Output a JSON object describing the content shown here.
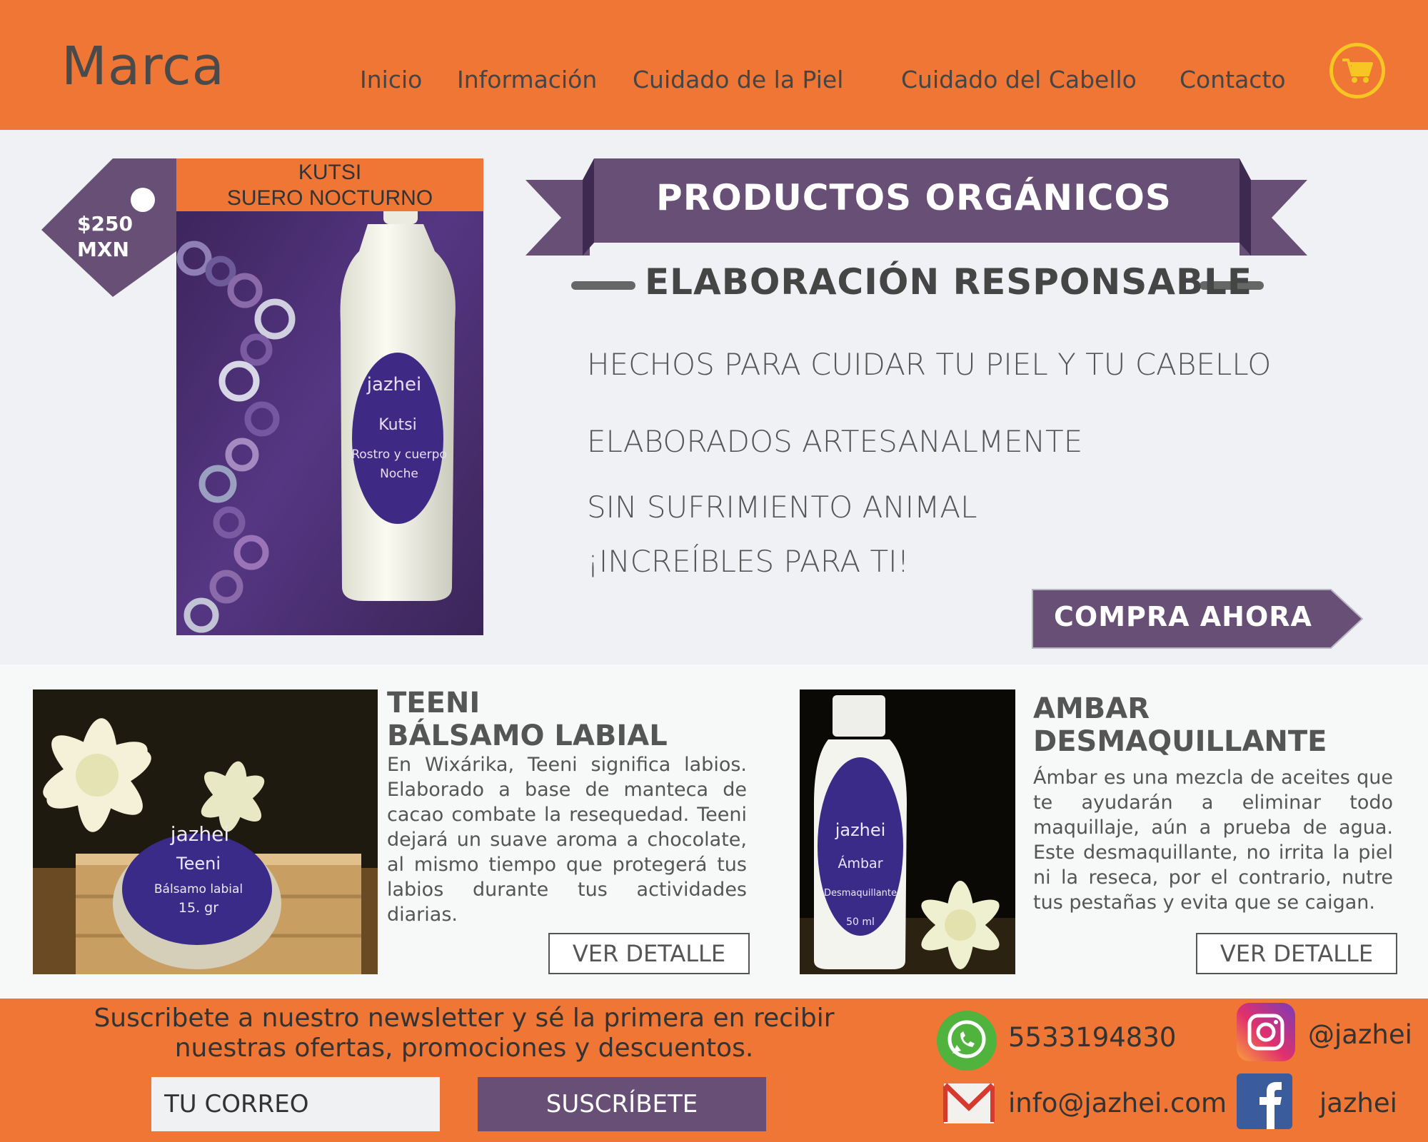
{
  "header": {
    "logo": "Marca",
    "nav": [
      "Inicio",
      "Información",
      "Cuidado de la Piel",
      "Cuidado del Cabello",
      "Contacto"
    ],
    "cart_icon": "shopping-cart-icon"
  },
  "hero": {
    "featured_product": {
      "title_line1": "KUTSI",
      "title_line2": "SUERO NOCTURNO",
      "price_line1": "$250",
      "price_line2": "MXN",
      "label_brand": "jazhei",
      "label_name": "Kutsi",
      "label_line1": "Rostro y cuerpo",
      "label_line2": "Noche"
    },
    "banner": "PRODUCTOS ORGÁNICOS",
    "subheading": "ELABORACIÓN RESPONSABLE",
    "features": [
      "HECHOS PARA CUIDAR TU PIEL Y  TU CABELLO",
      "ELABORADOS ARTESANALMENTE",
      "SIN SUFRIMIENTO ANIMAL",
      "¡INCREÍBLES PARA TI!"
    ],
    "cta": "COMPRA AHORA"
  },
  "products": [
    {
      "title_line1": "TEENI",
      "title_line2": "BÁLSAMO LABIAL",
      "description": "En Wixárika, Teeni significa labios. Elaborado a base de manteca de cacao combate la resequedad. Teeni dejará un suave aroma a chocolate, al mismo tiempo que protegerá tus labios durante tus actividades diarias.",
      "button": "VER DETALLE",
      "label_brand": "jazhei",
      "label_name": "Teeni",
      "label_line1": "Bálsamo labial",
      "label_line2": "15. gr"
    },
    {
      "title_line1": "AMBAR",
      "title_line2": "DESMAQUILLANTE",
      "description": "Ámbar es una mezcla de aceites que te ayudarán a eliminar todo maquillaje, aún a prueba de agua. Este desmaquillante, no irrita la piel ni la reseca, por el contrario, nutre tus pestañas y evita que se caigan.",
      "button": "VER DETALLE",
      "label_brand": "jazhei",
      "label_name": "Ámbar",
      "label_line1": "Desmaquillante",
      "label_line2": "50 ml"
    }
  ],
  "footer": {
    "newsletter_line1": "Suscribete a nuestro newsletter y sé la primera en recibir",
    "newsletter_line2": "nuestras ofertas, promociones y descuentos.",
    "email_placeholder": "TU CORREO",
    "subscribe": "SUSCRÍBETE",
    "phone": "5533194830",
    "email": "info@jazhei.com",
    "instagram": "@jazhei",
    "facebook": "jazhei"
  },
  "colors": {
    "orange": "#ef7634",
    "purple": "#674f75",
    "hero_bg": "#f0f1f5",
    "cart_yellow": "#f6c623"
  }
}
